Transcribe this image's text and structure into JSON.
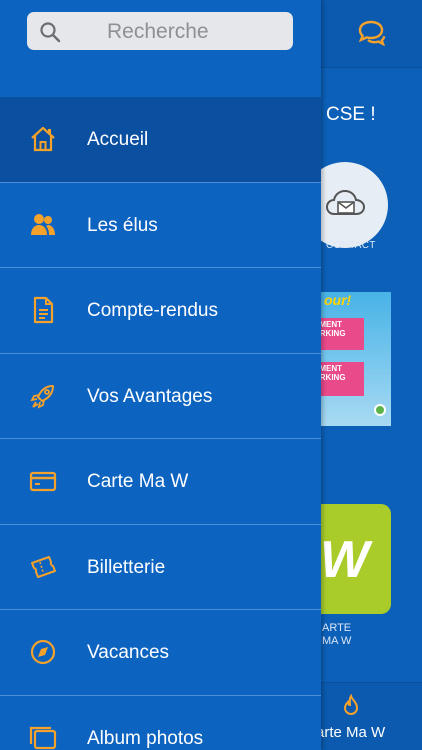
{
  "colors": {
    "drawer_bg": "#0d63c0",
    "drawer_active": "#0a4fa0",
    "icon_orange": "#f4a22b",
    "app_bg": "#0c60b8"
  },
  "search": {
    "placeholder": "Recherche",
    "icon": "search-icon"
  },
  "menu": {
    "items": [
      {
        "label": "Accueil",
        "icon": "home-icon",
        "active": true
      },
      {
        "label": "Les élus",
        "icon": "users-icon"
      },
      {
        "label": "Compte-rendus",
        "icon": "document-icon"
      },
      {
        "label": "Vos Avantages",
        "icon": "rocket-icon"
      },
      {
        "label": "Carte Ma W",
        "icon": "card-icon"
      },
      {
        "label": "Billetterie",
        "icon": "ticket-icon"
      },
      {
        "label": "Vacances",
        "icon": "compass-icon"
      },
      {
        "label": "Album photos",
        "icon": "photos-icon"
      }
    ]
  },
  "background": {
    "title_partial": "CSE !",
    "contact_label": "CONTACT",
    "promo_badge": "our!",
    "promo_tag1": "EMENT ARKING",
    "promo_tag2": "EMENT ARKING",
    "carte_label_line1": "ARTE",
    "carte_label_line2": "MA W",
    "tab_label": "arte Ma W"
  }
}
